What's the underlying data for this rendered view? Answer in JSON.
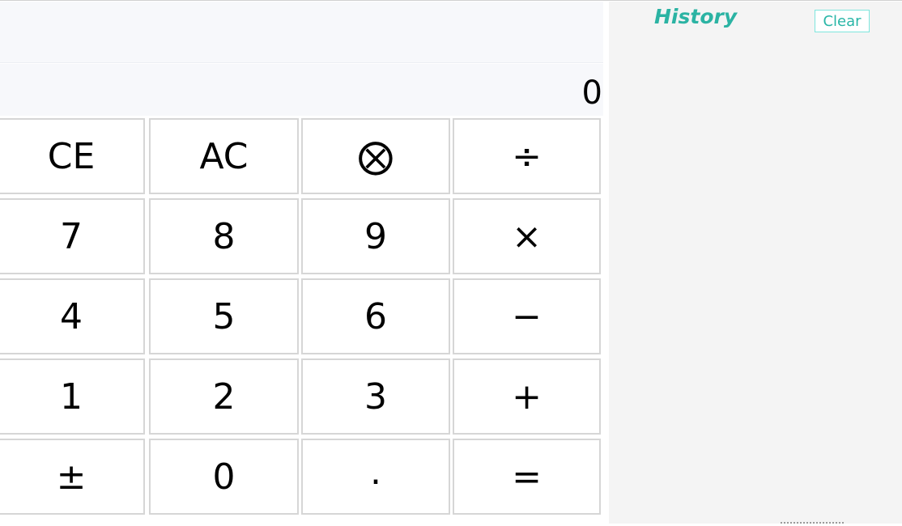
{
  "calculator": {
    "expression": "",
    "display": "0",
    "keys": {
      "ce": "CE",
      "ac": "AC",
      "backspace": "⨂",
      "divide": "÷",
      "seven": "7",
      "eight": "8",
      "nine": "9",
      "multiply": "×",
      "four": "4",
      "five": "5",
      "six": "6",
      "minus": "−",
      "one": "1",
      "two": "2",
      "three": "3",
      "plus": "+",
      "negate": "±",
      "zero": "0",
      "decimal": ".",
      "equals": "="
    }
  },
  "history": {
    "title": "History",
    "clear_label": "Clear",
    "entries": []
  },
  "colors": {
    "accent": "#2bb3a3",
    "display_bg": "#f7f8fb",
    "key_border": "#d6d6d6",
    "history_bg": "#f4f4f4"
  }
}
